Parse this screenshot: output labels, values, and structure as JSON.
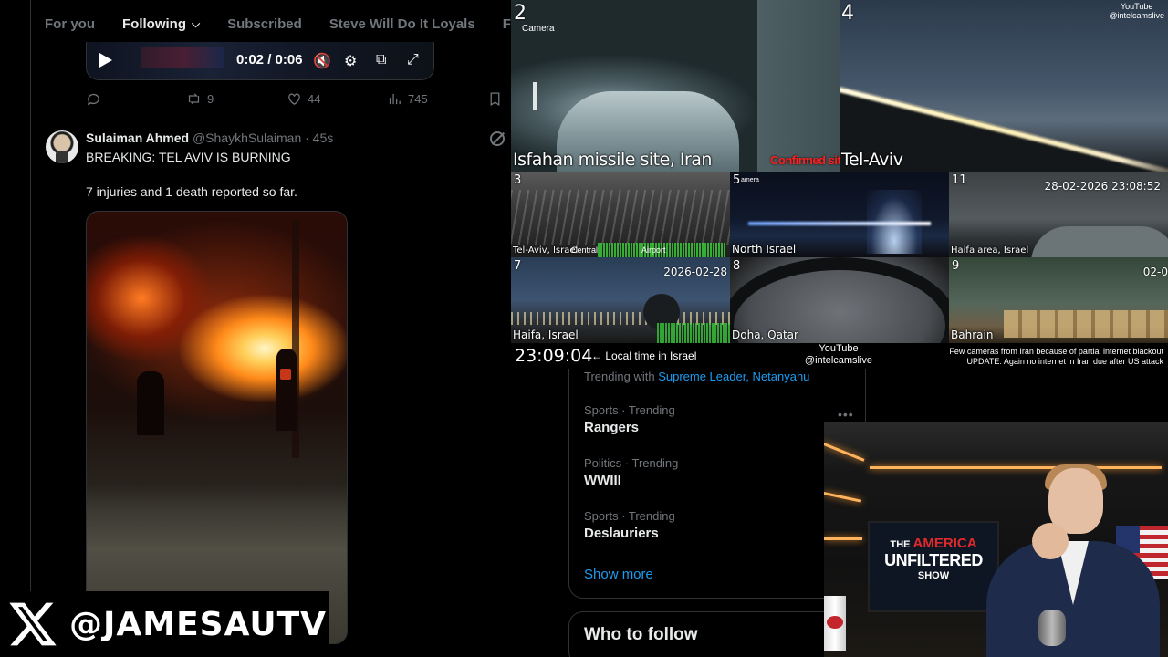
{
  "tabs": [
    {
      "label": "For you"
    },
    {
      "label": "Following",
      "active": true
    },
    {
      "label": "Subscribed"
    },
    {
      "label": "Steve Will Do It Loyals"
    },
    {
      "label": "Full S"
    }
  ],
  "video": {
    "time": "0:02 / 0:06"
  },
  "actions": {
    "reposts": "9",
    "likes": "44",
    "views": "745"
  },
  "post": {
    "author_name": "Sulaiman Ahmed",
    "author_handle": "@ShaykhSulaiman",
    "time": "· 45s",
    "headline": "BREAKING: TEL AVIV IS BURNING",
    "body": "7 injuries and 1 death reported so far."
  },
  "watermark": {
    "handle": "@JAMESAUTV"
  },
  "cameras": {
    "yt_corner_line1": "YouTube",
    "yt_corner_line2": "@intelcamslive",
    "cam2": {
      "num": "2",
      "sub": "Camera",
      "label": "Isfahan missile site, Iran",
      "confirmed": "Confirmed site"
    },
    "cam4": {
      "num": "4",
      "label": "Tel-Aviv"
    },
    "cam3": {
      "num": "3",
      "label": "Tel-Aviv, Israel",
      "sub1": "Central",
      "sub2": "Airport"
    },
    "cam5": {
      "num": "5",
      "sub": "amera",
      "label": "North Israel"
    },
    "cam11": {
      "num": "11",
      "timestamp": "28-02-2026 23:08:52",
      "label": "Haifa area, Israel"
    },
    "cam7": {
      "num": "7",
      "timestamp": "2026-02-28",
      "label": "Haifa, Israel"
    },
    "cam8": {
      "num": "8",
      "label": "Doha, Qatar"
    },
    "cam9": {
      "num": "9",
      "timestamp": "02-0",
      "label": "Bahrain"
    },
    "footer": {
      "clock": "23:09:04",
      "local_note": "← Local time in Israel",
      "yt_line1": "YouTube",
      "yt_line2": "@intelcamslive",
      "outage_line1": "Few cameras from Iran because of partial internet blackout",
      "outage_line2": "UPDATE: Again no internet in Iran due after US attack"
    }
  },
  "trends": {
    "trending_with_prefix": "Trending with",
    "trending_with_links": "Supreme Leader, Netanyahu",
    "items": [
      {
        "meta": "Sports · Trending",
        "name": "Rangers"
      },
      {
        "meta": "Politics · Trending",
        "name": "WWIII"
      },
      {
        "meta": "Sports · Trending",
        "name": "Deslauriers"
      }
    ],
    "show_more": "Show more",
    "who_to_follow": "Who to follow"
  },
  "webcam": {
    "logo_line1a": "THE ",
    "logo_line1b": "AMERICA",
    "logo_line2": "UNFILTERED",
    "logo_line3": "SHOW"
  },
  "colors": {
    "accent": "#1d9bf0",
    "confirmed": "#ff2020",
    "background": "#000000"
  }
}
